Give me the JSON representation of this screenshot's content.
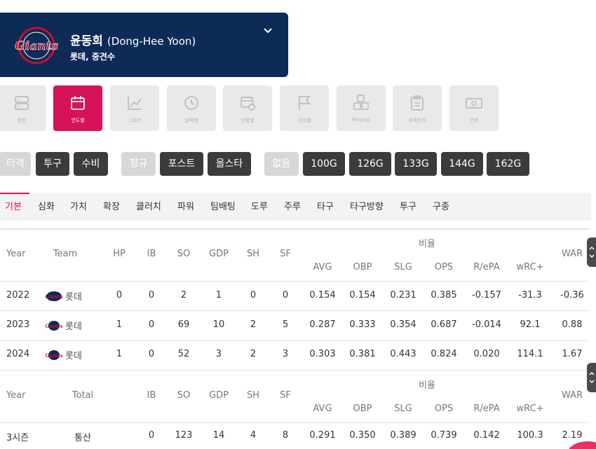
{
  "player": {
    "name_ko": "윤동희",
    "name_en": "(Dong-Hee Yoon)",
    "subtitle": "롯데, 중견수",
    "team_logo_text": "Giants",
    "brand_color": "#0e2a57"
  },
  "tiles": [
    {
      "label": "종합",
      "icon": "server-icon"
    },
    {
      "label": "연도별",
      "icon": "calendar-icon",
      "active": true
    },
    {
      "label": "그래프",
      "icon": "chart-icon"
    },
    {
      "label": "날짜별",
      "icon": "clock-icon"
    },
    {
      "label": "상황별",
      "icon": "gear-table-icon"
    },
    {
      "label": "상대별",
      "icon": "flag-icon"
    },
    {
      "label": "Playlog",
      "icon": "abc-blocks-icon"
    },
    {
      "label": "상세분석",
      "icon": "clipboard-icon"
    },
    {
      "label": "연봉",
      "icon": "money-icon"
    }
  ],
  "filters": {
    "type": [
      "타격",
      "투구",
      "수비"
    ],
    "season": [
      "정규",
      "포스트",
      "올스타"
    ],
    "games": [
      "없음",
      "100G",
      "126G",
      "133G",
      "144G",
      "162G"
    ]
  },
  "subtabs": [
    "기본",
    "심화",
    "가치",
    "확장",
    "클러치",
    "파워",
    "팀배팅",
    "도루",
    "주루",
    "타구",
    "타구방향",
    "투구",
    "구종"
  ],
  "accent_color": "#d6125b",
  "table1": {
    "group_label": "비율",
    "headers": {
      "year": "Year",
      "team": "Team",
      "hp": "HP",
      "ib": "IB",
      "so": "SO",
      "gdp": "GDP",
      "sh": "SH",
      "sf": "SF",
      "avg": "AVG",
      "obp": "OBP",
      "slg": "SLG",
      "ops": "OPS",
      "repa": "R/ePA",
      "wrc": "wRC+",
      "war": "WAR"
    },
    "rows": [
      {
        "year": "2022",
        "team": "롯데",
        "hp": "0",
        "ib": "0",
        "so": "2",
        "gdp": "1",
        "sh": "0",
        "sf": "0",
        "avg": "0.154",
        "obp": "0.154",
        "slg": "0.231",
        "ops": "0.385",
        "repa": "-0.157",
        "wrc": "-31.3",
        "war": "-0.36"
      },
      {
        "year": "2023",
        "team": "롯데",
        "hp": "1",
        "ib": "0",
        "so": "69",
        "gdp": "10",
        "sh": "2",
        "sf": "5",
        "avg": "0.287",
        "obp": "0.333",
        "slg": "0.354",
        "ops": "0.687",
        "repa": "-0.014",
        "wrc": "92.1",
        "war": "0.88"
      },
      {
        "year": "2024",
        "team": "롯데",
        "hp": "1",
        "ib": "0",
        "so": "52",
        "gdp": "3",
        "sh": "2",
        "sf": "3",
        "avg": "0.303",
        "obp": "0.381",
        "slg": "0.443",
        "ops": "0.824",
        "repa": "0.020",
        "wrc": "114.1",
        "war": "1.67"
      }
    ]
  },
  "table2": {
    "group_label": "비율",
    "headers": {
      "year": "Year",
      "total": "Total",
      "ib": "IB",
      "so": "SO",
      "gdp": "GDP",
      "sh": "SH",
      "sf": "SF",
      "avg": "AVG",
      "obp": "OBP",
      "slg": "SLG",
      "ops": "OPS",
      "repa": "R/ePA",
      "wrc": "wRC+",
      "war": "WAR"
    },
    "rows": [
      {
        "year": "3시즌",
        "total": "통산",
        "ib": "0",
        "so": "123",
        "gdp": "14",
        "sh": "4",
        "sf": "8",
        "avg": "0.291",
        "obp": "0.350",
        "slg": "0.389",
        "ops": "0.739",
        "repa": "0.142",
        "wrc": "100.3",
        "war": "2.19"
      }
    ]
  }
}
